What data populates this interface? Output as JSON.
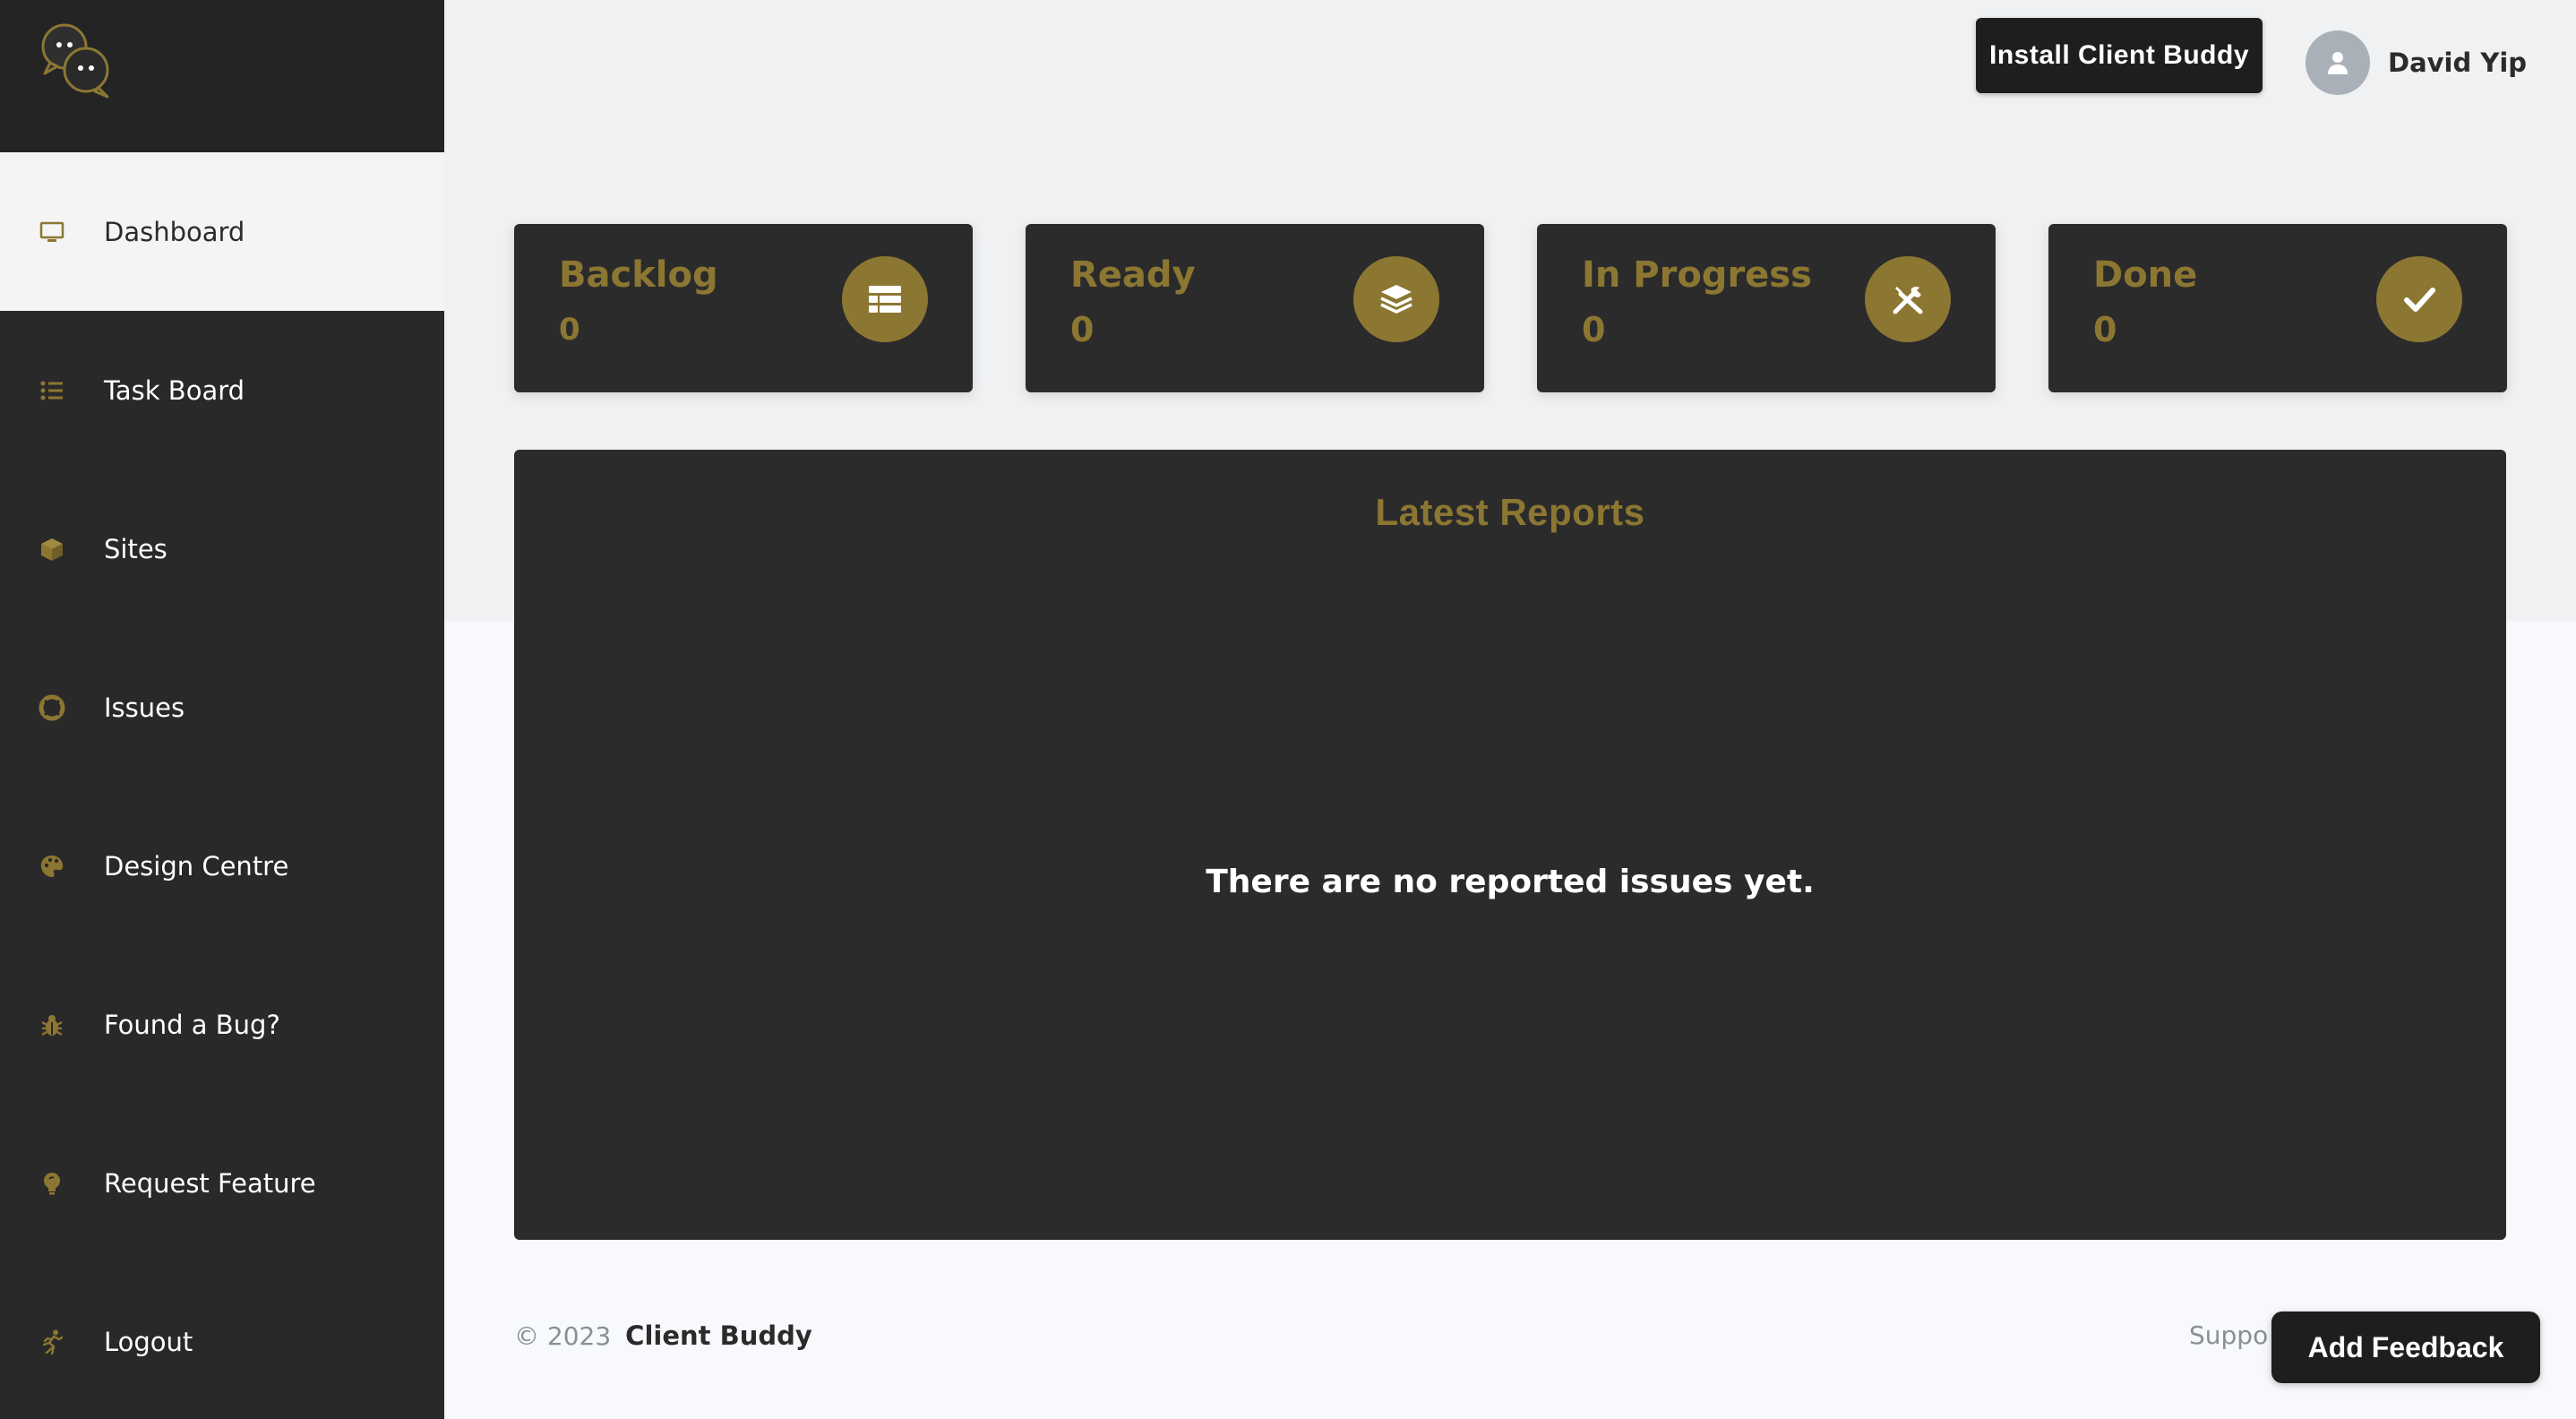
{
  "brand": {
    "logo_icon": "chat-bubbles-logo",
    "name": "Client Buddy"
  },
  "colors": {
    "sidebar_bg": "#292929",
    "card_bg": "#2b2b2b",
    "accent_gold": "#8c7732",
    "active_nav_bg": "#f4f4f4",
    "page_bg": "#f0f1f3"
  },
  "sidebar": {
    "items": [
      {
        "label": "Dashboard",
        "icon": "monitor-icon",
        "active": true
      },
      {
        "label": "Task Board",
        "icon": "list-icon",
        "active": false
      },
      {
        "label": "Sites",
        "icon": "cube-icon",
        "active": false
      },
      {
        "label": "Issues",
        "icon": "lifebuoy-icon",
        "active": false
      },
      {
        "label": "Design Centre",
        "icon": "palette-icon",
        "active": false
      },
      {
        "label": "Found a Bug?",
        "icon": "bug-icon",
        "active": false
      },
      {
        "label": "Request Feature",
        "icon": "lightbulb-icon",
        "active": false
      },
      {
        "label": "Logout",
        "icon": "running-person-icon",
        "active": false
      }
    ]
  },
  "header": {
    "install_label": "Install Client Buddy",
    "user_name": "David Yip",
    "avatar_icon": "user-icon"
  },
  "stats": [
    {
      "title": "Backlog",
      "count": "0",
      "icon": "table-icon"
    },
    {
      "title": "Ready",
      "count": "0",
      "icon": "layers-icon"
    },
    {
      "title": "In Progress",
      "count": "0",
      "icon": "tools-icon"
    },
    {
      "title": "Done",
      "count": "0",
      "icon": "check-icon"
    }
  ],
  "reports": {
    "title": "Latest Reports",
    "empty_message": "There are no reported issues yet."
  },
  "footer": {
    "year": "© 2023",
    "brand": "Client Buddy",
    "support_label": "Suppo",
    "feedback_label": "Add Feedback"
  }
}
